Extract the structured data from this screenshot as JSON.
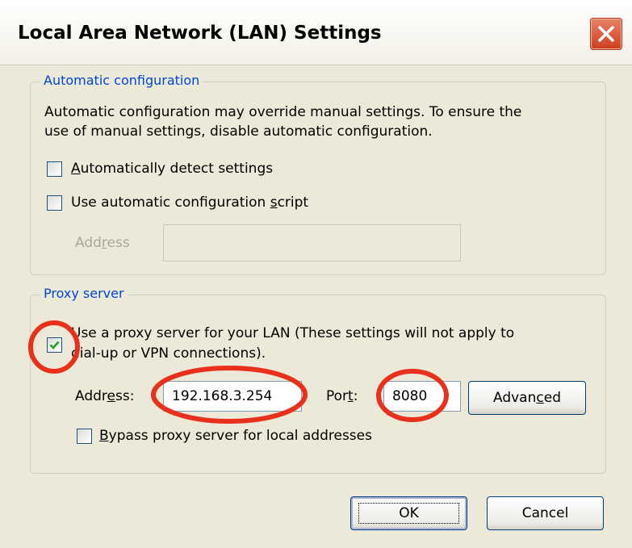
{
  "window": {
    "title": "Local Area Network (LAN) Settings"
  },
  "auto_config": {
    "legend": "Automatic configuration",
    "description_line1": "Automatic configuration may override manual settings.  To ensure the",
    "description_line2": "use of manual settings, disable automatic configuration.",
    "detect": {
      "pre": "",
      "key": "A",
      "post": "utomatically detect settings",
      "checked": false
    },
    "script": {
      "pre": "Use automatic configuration ",
      "key": "s",
      "post": "cript",
      "checked": false
    },
    "address": {
      "pre": "Add",
      "key": "r",
      "post": "ess",
      "value": ""
    }
  },
  "proxy": {
    "legend": "Proxy server",
    "use_proxy": {
      "line1": "Use a proxy server for your LAN (These settings will not apply to",
      "line2": "dial-up or VPN connections).",
      "checked": true
    },
    "address": {
      "pre": "Addr",
      "key": "e",
      "post": "ss:",
      "value": "192.168.3.254"
    },
    "port": {
      "pre": "Por",
      "key": "t",
      "post": ":",
      "value": "8080"
    },
    "advanced": {
      "pre": "Advan",
      "key": "c",
      "post": "ed"
    },
    "bypass": {
      "pre": "",
      "key": "B",
      "post": "ypass proxy server for local addresses",
      "checked": false
    }
  },
  "buttons": {
    "ok": "OK",
    "cancel": "Cancel"
  },
  "colors": {
    "annotation": "#e8301c",
    "legend_text": "#0046d5",
    "checkmark": "#21a121",
    "dialog_bg": "#ece9d8"
  },
  "icons": {
    "close": "close-icon",
    "check": "checkmark-icon"
  }
}
